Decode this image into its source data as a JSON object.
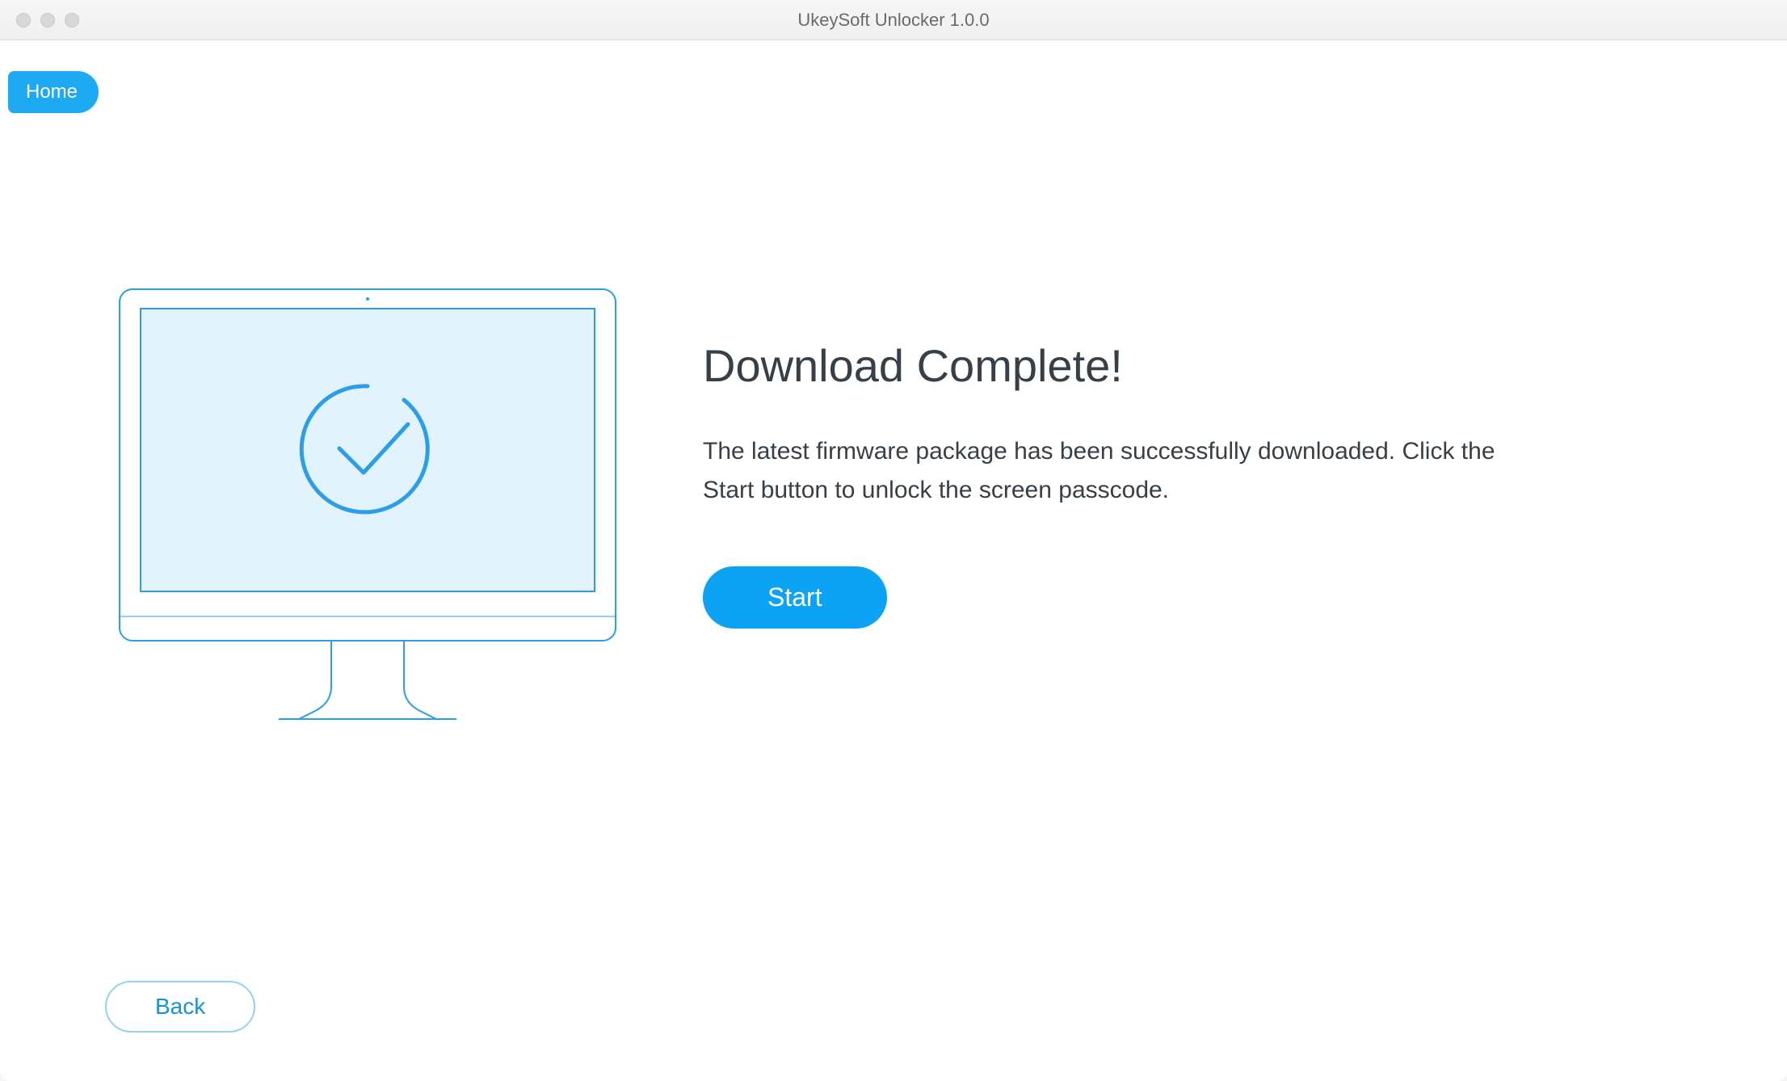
{
  "window": {
    "title": "UkeySoft Unlocker 1.0.0"
  },
  "nav": {
    "home_label": "Home"
  },
  "main": {
    "heading": "Download Complete!",
    "body_text": "The latest firmware package has been successfully downloaded. Click the Start button to unlock the screen passcode.",
    "start_label": "Start"
  },
  "footer": {
    "back_label": "Back"
  }
}
